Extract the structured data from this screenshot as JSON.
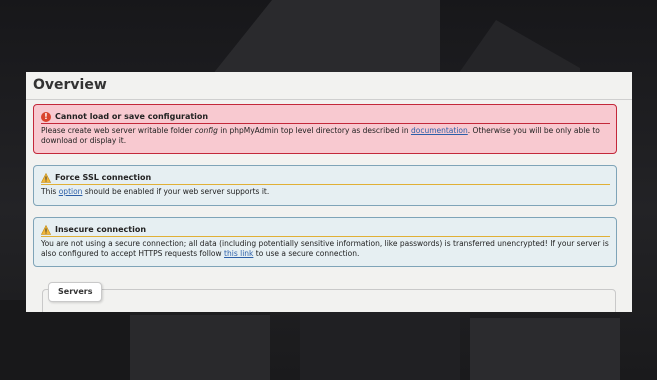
{
  "page": {
    "title": "Overview"
  },
  "messages": {
    "config_error": {
      "heading": "Cannot load or save configuration",
      "text1": "Please create web server writable folder ",
      "em": "config",
      "text2": " in phpMyAdmin top level directory as described in ",
      "link": "documentation",
      "text3": ". Otherwise you will be only able to download or display it."
    },
    "force_ssl": {
      "heading": "Force SSL connection",
      "text1": "This ",
      "link": "option",
      "text2": " should be enabled if your web server supports it."
    },
    "insecure": {
      "heading": "Insecure connection",
      "text1": "You are not using a secure connection; all data (including potentially sensitive information, like passwords) is transferred unencrypted! If your server is also configured to accept HTTPS requests follow ",
      "link": "this link",
      "text2": " to use a secure connection."
    }
  },
  "servers": {
    "label": "Servers"
  },
  "icons": {
    "error": "error-icon",
    "warning": "warning-icon"
  },
  "colors": {
    "error_bg": "#f8c9d0",
    "error_border": "#c3283a",
    "notice_bg": "#e6eff2",
    "notice_border": "#7fa4b8"
  }
}
